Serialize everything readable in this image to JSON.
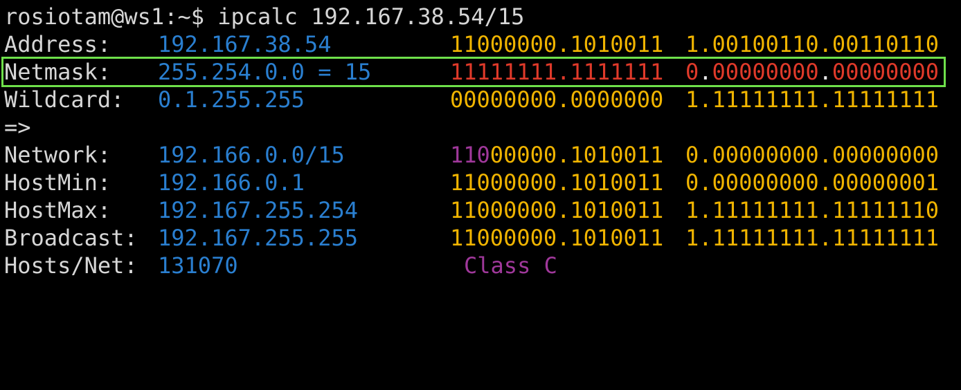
{
  "prompt": {
    "text": "rosiotam@ws1:~$ ipcalc 192.167.38.54/15"
  },
  "rows": {
    "address": {
      "label": "Address:",
      "value": "192.167.38.54",
      "bin_a": "11000000.1010011",
      "dot_a": "",
      "bin_b": "1.00100110.00110110"
    },
    "netmask": {
      "label": "Netmask:",
      "value": "255.254.0.0 = 15",
      "bin_a": "11111111.1111111",
      "bin_b_first": "0",
      "bin_b_dot1": ".",
      "bin_b_mid": "00000000",
      "bin_b_dot2": ".",
      "bin_b_last": "00000000"
    },
    "wildcard": {
      "label": "Wildcard:",
      "value": "0.1.255.255",
      "bin_a": "00000000.0000000",
      "bin_b": "1.11111111.11111111"
    },
    "arrow": {
      "text": "=>"
    },
    "network": {
      "label": "Network:",
      "value": "192.166.0.0/15",
      "bin_a_class": "110",
      "bin_a_rest": "00000.1010011",
      "bin_b": "0.00000000.00000000"
    },
    "hostmin": {
      "label": "HostMin:",
      "value": "192.166.0.1",
      "bin_a": "11000000.1010011",
      "bin_b": "0.00000000.00000001"
    },
    "hostmax": {
      "label": "HostMax:",
      "value": "192.167.255.254",
      "bin_a": "11000000.1010011",
      "bin_b": "1.11111111.11111110"
    },
    "broadcast": {
      "label": "Broadcast:",
      "value": "192.167.255.255",
      "bin_a": "11000000.1010011",
      "bin_b": "1.11111111.11111111"
    },
    "hostsnet": {
      "label": "Hosts/Net:",
      "value": "131070",
      "class_text": "Class C"
    }
  },
  "colors": {
    "background": "#000000",
    "default_text": "#d6d6d6",
    "ip_value": "#2a7fd0",
    "binary": "#f0b400",
    "netmask_binary": "#e03a2a",
    "class_bits": "#a0389b",
    "highlight_border": "#6ee04a"
  }
}
